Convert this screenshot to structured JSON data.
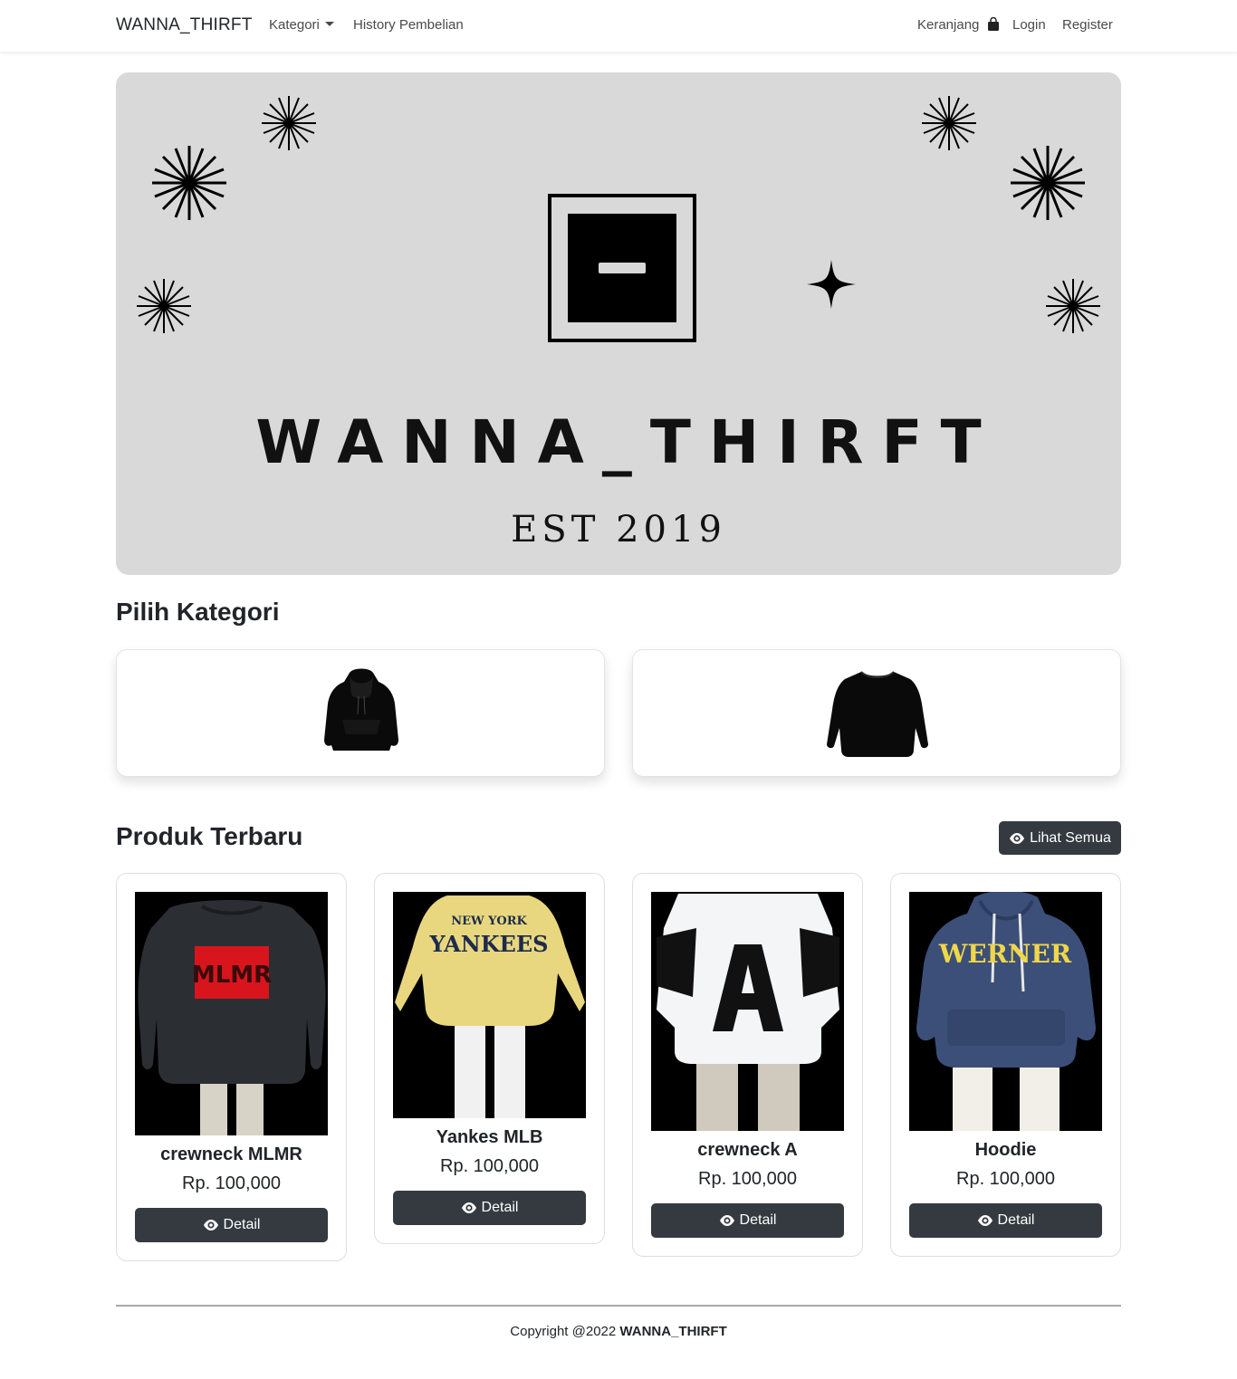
{
  "navbar": {
    "brand": "WANNA_THIRFT",
    "kategori": "Kategori",
    "history": "History Pembelian",
    "cart": "Keranjang",
    "login": "Login",
    "register": "Register"
  },
  "hero": {
    "title": "WANNA_THIRFT",
    "est": "EST 2019"
  },
  "sections": {
    "kategori_title": "Pilih Kategori",
    "produk_title": "Produk Terbaru",
    "lihat_semua": "Lihat Semua"
  },
  "categories": [
    {
      "name": "hoodie-category",
      "icon": "hoodie-icon"
    },
    {
      "name": "crewneck-category",
      "icon": "crewneck-icon"
    }
  ],
  "products": [
    {
      "name": "crewneck MLMR",
      "price": "Rp. 100,000",
      "button": "Detail",
      "print": "MLMR",
      "color": "#2b2e33",
      "print_color": "#d8151c"
    },
    {
      "name": "Yankes MLB",
      "price": "Rp. 100,000",
      "button": "Detail",
      "print": "YANKEES",
      "print_top": "NEW YORK",
      "color": "#e8d77e",
      "print_color": "#1d2b4d"
    },
    {
      "name": "crewneck A",
      "price": "Rp. 100,000",
      "button": "Detail",
      "print": "A",
      "color": "#f4f5f7",
      "print_color": "#111111"
    },
    {
      "name": "Hoodie",
      "price": "Rp. 100,000",
      "button": "Detail",
      "print": "WERNER",
      "color": "#3b4f78",
      "print_color": "#f0d64a"
    }
  ],
  "footer": {
    "text": "Copyright @2022",
    "brand": "WANNA_THIRFT"
  },
  "colors": {
    "hero_bg": "#d9d9d9",
    "button_dark": "#343a40"
  }
}
